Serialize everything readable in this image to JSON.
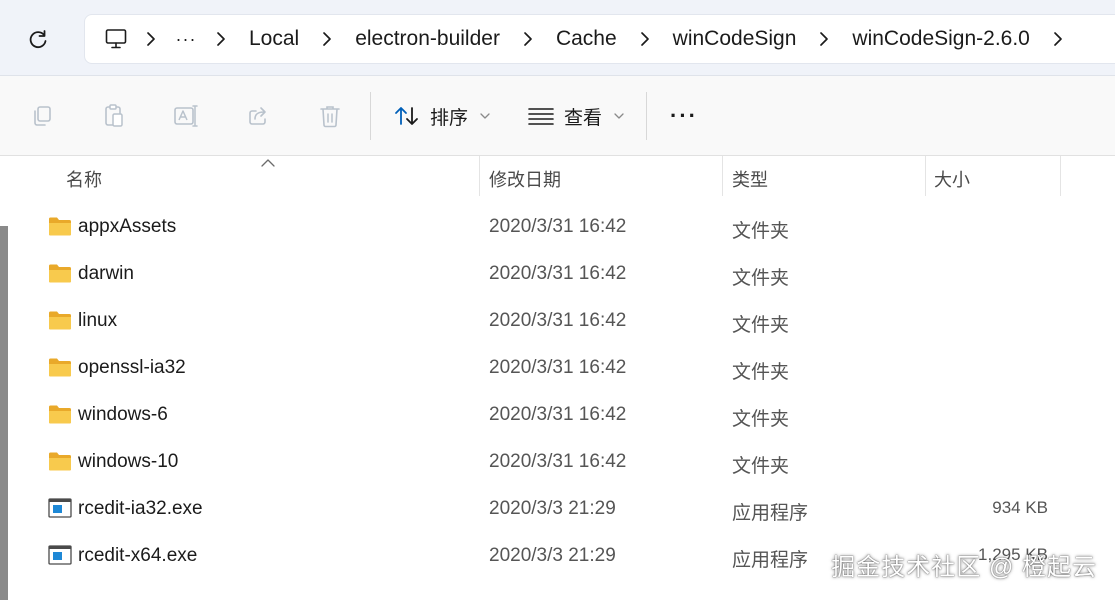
{
  "breadcrumb": {
    "more": "···",
    "items": [
      "Local",
      "electron-builder",
      "Cache",
      "winCodeSign",
      "winCodeSign-2.6.0"
    ]
  },
  "toolbar": {
    "sort_label": "排序",
    "view_label": "查看",
    "more_label": "···"
  },
  "columns": {
    "name": "名称",
    "date": "修改日期",
    "type": "类型",
    "size": "大小"
  },
  "files": [
    {
      "icon": "folder-icon",
      "name": "appxAssets",
      "date": "2020/3/31 16:42",
      "type": "文件夹",
      "size": ""
    },
    {
      "icon": "folder-icon",
      "name": "darwin",
      "date": "2020/3/31 16:42",
      "type": "文件夹",
      "size": ""
    },
    {
      "icon": "folder-icon",
      "name": "linux",
      "date": "2020/3/31 16:42",
      "type": "文件夹",
      "size": ""
    },
    {
      "icon": "folder-icon",
      "name": "openssl-ia32",
      "date": "2020/3/31 16:42",
      "type": "文件夹",
      "size": ""
    },
    {
      "icon": "folder-icon",
      "name": "windows-6",
      "date": "2020/3/31 16:42",
      "type": "文件夹",
      "size": ""
    },
    {
      "icon": "folder-icon",
      "name": "windows-10",
      "date": "2020/3/31 16:42",
      "type": "文件夹",
      "size": ""
    },
    {
      "icon": "exe-icon",
      "name": "rcedit-ia32.exe",
      "date": "2020/3/3 21:29",
      "type": "应用程序",
      "size": "934 KB"
    },
    {
      "icon": "exe-icon",
      "name": "rcedit-x64.exe",
      "date": "2020/3/3 21:29",
      "type": "应用程序",
      "size": "1,295 KB"
    }
  ],
  "watermark": "掘金技术社区 @ 橙起云",
  "colors": {
    "folder": "#f6c445",
    "accent": "#005fb8"
  }
}
